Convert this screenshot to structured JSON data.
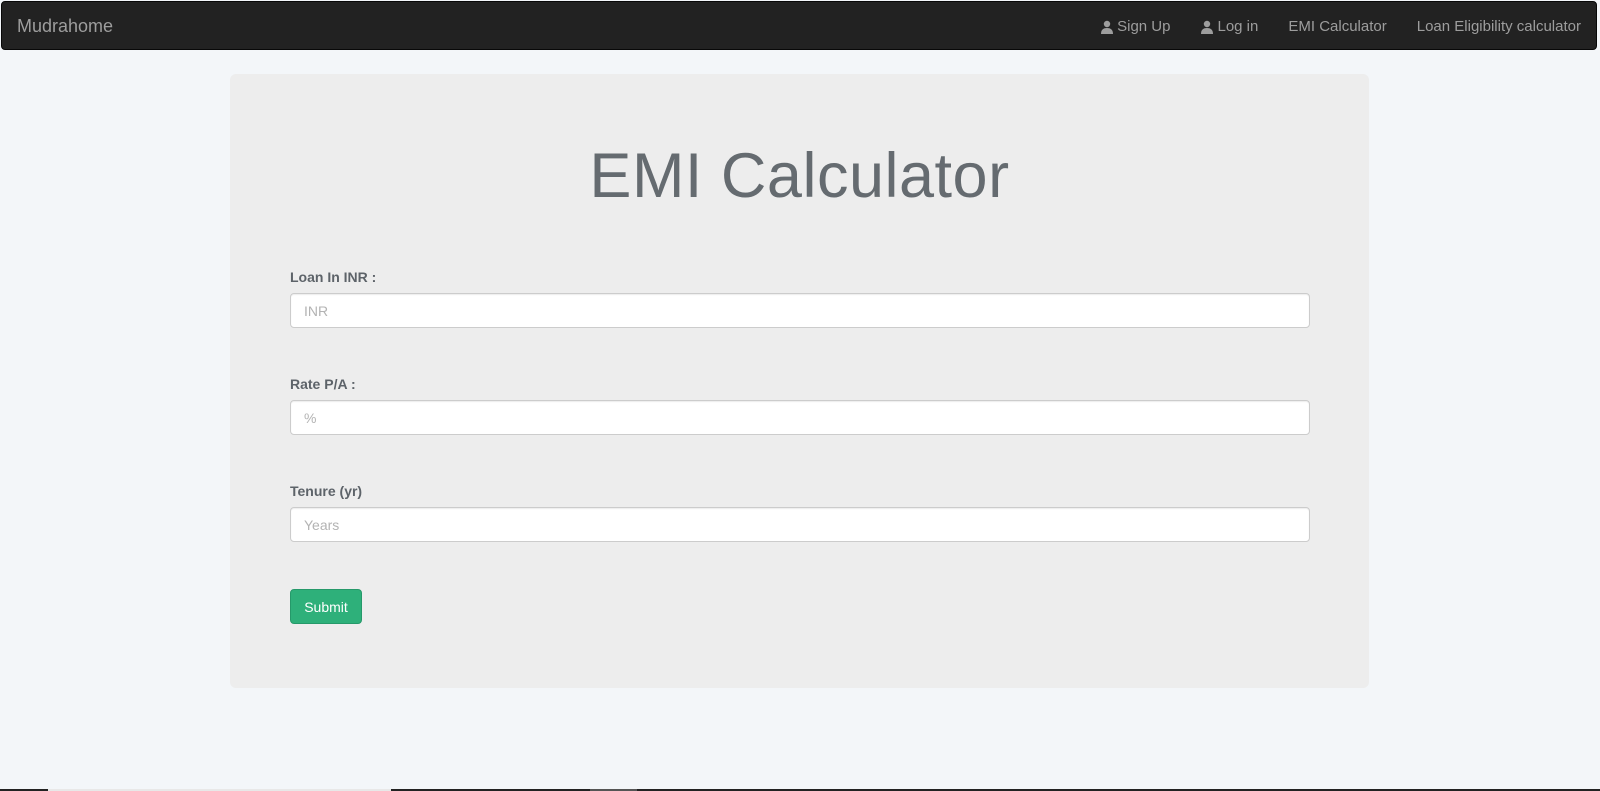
{
  "navbar": {
    "brand": "Mudrahome",
    "links": [
      {
        "label": "Sign Up",
        "icon": "user-icon"
      },
      {
        "label": "Log in",
        "icon": "user-icon"
      },
      {
        "label": "EMI Calculator"
      },
      {
        "label": "Loan Eligibility calculator"
      }
    ]
  },
  "main": {
    "title": "EMI Calculator",
    "fields": [
      {
        "label": "Loan In INR :",
        "placeholder": "INR",
        "value": ""
      },
      {
        "label": "Rate P/A :",
        "placeholder": "%",
        "value": ""
      },
      {
        "label": "Tenure (yr)",
        "placeholder": "Years",
        "value": ""
      }
    ],
    "submit_label": "Submit"
  },
  "colors": {
    "navbar_bg": "#222222",
    "nav_text": "#9d9d9d",
    "page_bg": "#f3f6f9",
    "jumbotron_bg": "#ededed",
    "submit_bg": "#2eb07a"
  }
}
